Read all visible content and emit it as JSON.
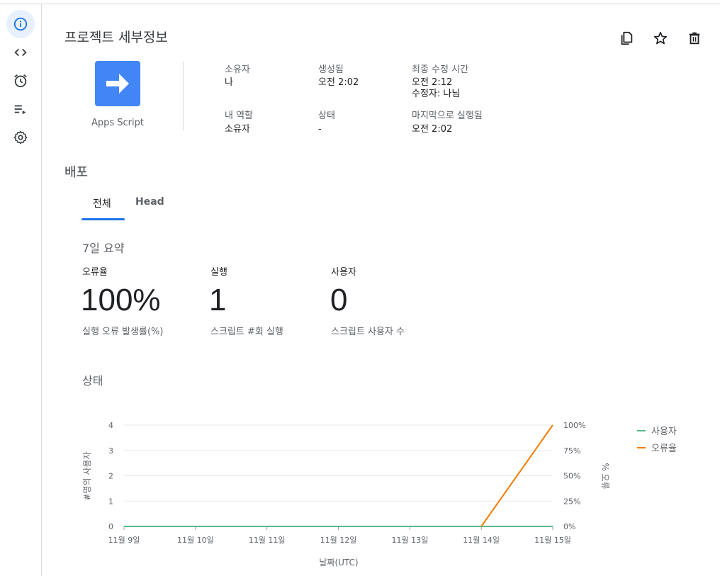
{
  "page": {
    "title": "프로젝트 세부정보"
  },
  "sidebar": {
    "items": [
      {
        "name": "info-icon",
        "active": true
      },
      {
        "name": "code-icon",
        "active": false
      },
      {
        "name": "alarm-icon",
        "active": false
      },
      {
        "name": "playlist-icon",
        "active": false
      },
      {
        "name": "gear-icon",
        "active": false
      }
    ]
  },
  "actions": [
    "copy-icon",
    "star-icon",
    "trash-icon"
  ],
  "app": {
    "name": "Apps Script",
    "brand_color": "#4285f4"
  },
  "info": {
    "owner_label": "소유자",
    "owner_value": "나",
    "created_label": "생성됨",
    "created_value": "오전 2:02",
    "modified_label": "최종 수정 시간",
    "modified_value": "오전 2:12",
    "modified_by": "수정자: 나님",
    "role_label": "내 역할",
    "role_value": "소유자",
    "status_label": "상태",
    "status_value": "-",
    "last_run_label": "마지막으로 실행됨",
    "last_run_value": "오전 2:02"
  },
  "deploy": {
    "title": "배포",
    "tabs": [
      {
        "label": "전체",
        "active": true
      },
      {
        "label": "Head",
        "active": false
      }
    ]
  },
  "summary": {
    "title": "7일 요약",
    "metrics": [
      {
        "label": "오류율",
        "value": "100%",
        "desc": "실행 오류 발생률(%)"
      },
      {
        "label": "실행",
        "value": "1",
        "desc": "스크립트 #회 실행"
      },
      {
        "label": "사용자",
        "value": "0",
        "desc": "스크립트 사용자 수"
      }
    ]
  },
  "status": {
    "title": "상태"
  },
  "chart_data": {
    "type": "line",
    "x": [
      "11월 9일",
      "11월 10일",
      "11월 11일",
      "11월 12일",
      "11월 13일",
      "11월 14일",
      "11월 15일"
    ],
    "xlabel": "날짜(UTC)",
    "ylabel": "#명의 사용자",
    "ylabel_right": "% 오류",
    "y_ticks_left": [
      "0",
      "1",
      "2",
      "3",
      "4"
    ],
    "y_ticks_right": [
      "0%",
      "25%",
      "50%",
      "75%",
      "100%"
    ],
    "ylim_left": [
      0,
      4
    ],
    "ylim_right": [
      0,
      100
    ],
    "grid": true,
    "legend_position": "right",
    "series": [
      {
        "name": "사용자",
        "axis": "left",
        "color": "#57bb8a",
        "values": [
          0,
          0,
          0,
          0,
          0,
          0,
          0
        ]
      },
      {
        "name": "오류율",
        "axis": "right",
        "color": "#f57c00",
        "values": [
          null,
          null,
          null,
          null,
          null,
          0,
          100
        ]
      }
    ]
  }
}
